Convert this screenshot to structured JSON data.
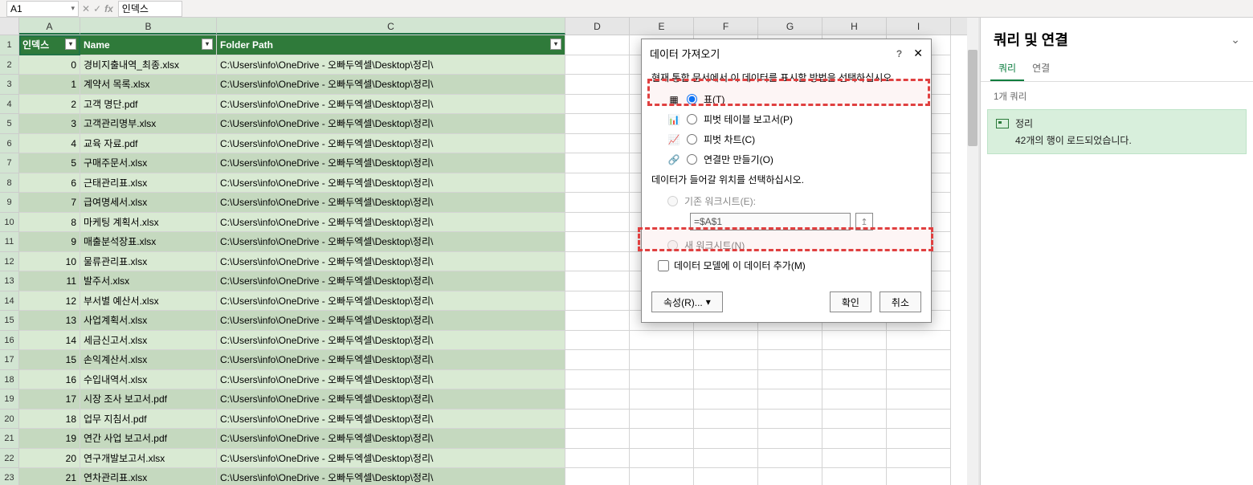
{
  "formula_bar": {
    "name_box": "A1",
    "formula_value": "인덱스"
  },
  "columns": [
    "A",
    "B",
    "C",
    "D",
    "E",
    "F",
    "G",
    "H",
    "I"
  ],
  "table": {
    "headers": {
      "index": "인덱스",
      "name": "Name",
      "path": "Folder Path"
    },
    "path_value": "C:\\Users\\info\\OneDrive - 오빠두엑셀\\Desktop\\정리\\",
    "rows": [
      {
        "i": 0,
        "name": "경비지출내역_최종.xlsx"
      },
      {
        "i": 1,
        "name": "계약서 목록.xlsx"
      },
      {
        "i": 2,
        "name": "고객 명단.pdf"
      },
      {
        "i": 3,
        "name": "고객관리명부.xlsx"
      },
      {
        "i": 4,
        "name": "교육 자료.pdf"
      },
      {
        "i": 5,
        "name": "구매주문서.xlsx"
      },
      {
        "i": 6,
        "name": "근태관리표.xlsx"
      },
      {
        "i": 7,
        "name": "급여명세서.xlsx"
      },
      {
        "i": 8,
        "name": "마케팅 계획서.xlsx"
      },
      {
        "i": 9,
        "name": "매출분석장표.xlsx"
      },
      {
        "i": 10,
        "name": "물류관리표.xlsx"
      },
      {
        "i": 11,
        "name": "발주서.xlsx"
      },
      {
        "i": 12,
        "name": "부서별 예산서.xlsx"
      },
      {
        "i": 13,
        "name": "사업계획서.xlsx"
      },
      {
        "i": 14,
        "name": "세금신고서.xlsx"
      },
      {
        "i": 15,
        "name": "손익계산서.xlsx"
      },
      {
        "i": 16,
        "name": "수입내역서.xlsx"
      },
      {
        "i": 17,
        "name": "시장 조사 보고서.pdf"
      },
      {
        "i": 18,
        "name": "업무 지침서.pdf"
      },
      {
        "i": 19,
        "name": "연간 사업 보고서.pdf"
      },
      {
        "i": 20,
        "name": "연구개발보고서.xlsx"
      },
      {
        "i": 21,
        "name": "연차관리표.xlsx"
      }
    ]
  },
  "dialog": {
    "title": "데이터 가져오기",
    "prompt": "현재 통합 문서에서 이 데이터를 표시할 방법을 선택하십시오.",
    "opt_table": "표(T)",
    "opt_pivot_report": "피벗 테이블 보고서(P)",
    "opt_pivot_chart": "피벗 차트(C)",
    "opt_connection": "연결만 만들기(O)",
    "where_prompt": "데이터가 들어갈 위치를 선택하십시오.",
    "opt_existing": "기존 워크시트(E):",
    "ref_value": "=$A$1",
    "opt_new": "새 워크시트(N)",
    "chk_model": "데이터 모델에 이 데이터 추가(M)",
    "btn_props": "속성(R)...",
    "btn_ok": "확인",
    "btn_cancel": "취소"
  },
  "panel": {
    "title": "쿼리 및 연결",
    "tab_queries": "쿼리",
    "tab_connections": "연결",
    "count": "1개 쿼리",
    "query_name": "정리",
    "query_status": "42개의 행이 로드되었습니다."
  }
}
